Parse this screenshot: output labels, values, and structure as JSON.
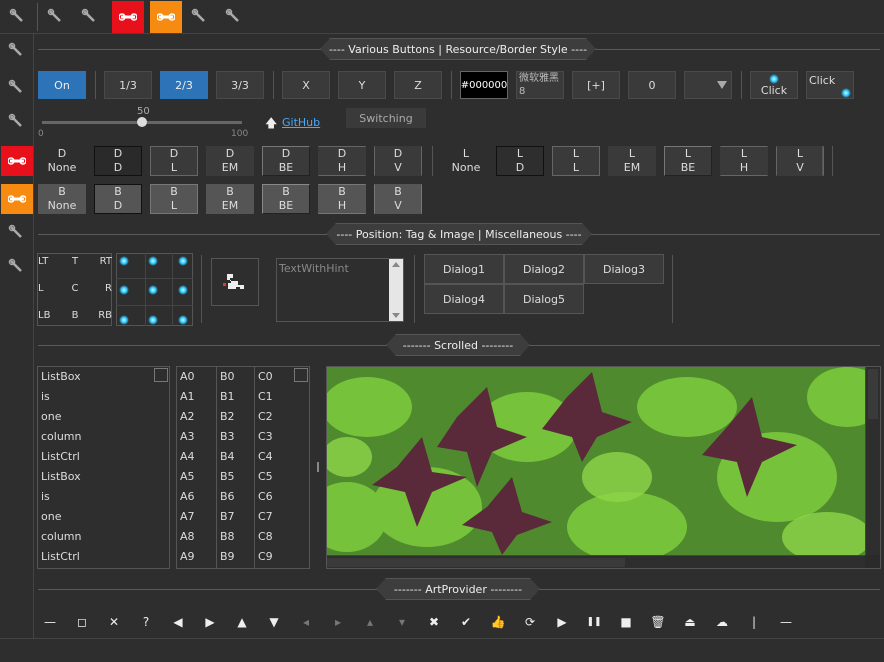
{
  "section_headers": {
    "buttons": "---- Various Buttons | Resource/Border Style ----",
    "position": "---- Position: Tag & Image | Miscellaneous ----",
    "scrolled": "------- Scrolled --------",
    "artprovider": "------- ArtProvider --------"
  },
  "buttons_row": {
    "on": "On",
    "frac1": "1/3",
    "frac2": "2/3",
    "frac3": "3/3",
    "x": "X",
    "y": "Y",
    "z": "Z",
    "color": "#000000",
    "font_line1": "微软雅黑",
    "font_line2": "8",
    "plus": "[+]",
    "zero": "0",
    "click1": "Click",
    "click2": "Click"
  },
  "slider": {
    "max_label": "50",
    "min": "0",
    "max": "100",
    "value": 50
  },
  "github_link": "GitHub",
  "switch_label": "Switching",
  "d_row": [
    {
      "l1": "D",
      "l2": "None"
    },
    {
      "l1": "D",
      "l2": "D"
    },
    {
      "l1": "D",
      "l2": "L"
    },
    {
      "l1": "D",
      "l2": "EM"
    },
    {
      "l1": "D",
      "l2": "BE"
    },
    {
      "l1": "D",
      "l2": "H"
    },
    {
      "l1": "D",
      "l2": "V"
    }
  ],
  "l_row": [
    {
      "l1": "L",
      "l2": "None"
    },
    {
      "l1": "L",
      "l2": "D"
    },
    {
      "l1": "L",
      "l2": "L"
    },
    {
      "l1": "L",
      "l2": "EM"
    },
    {
      "l1": "L",
      "l2": "BE"
    },
    {
      "l1": "L",
      "l2": "H"
    },
    {
      "l1": "L",
      "l2": "V"
    }
  ],
  "b_row": [
    {
      "l1": "B",
      "l2": "None"
    },
    {
      "l1": "B",
      "l2": "D"
    },
    {
      "l1": "B",
      "l2": "L"
    },
    {
      "l1": "B",
      "l2": "EM"
    },
    {
      "l1": "B",
      "l2": "BE"
    },
    {
      "l1": "B",
      "l2": "H"
    },
    {
      "l1": "B",
      "l2": "V"
    }
  ],
  "positions": [
    "LT",
    "T",
    "RT",
    "L",
    "C",
    "R",
    "LB",
    "B",
    "RB"
  ],
  "text_hint": "TextWithHint",
  "dialogs": [
    "Dialog1",
    "Dialog2",
    "Dialog3",
    "Dialog4",
    "Dialog5"
  ],
  "listbox": [
    "ListBox",
    "is",
    "one",
    "column",
    "ListCtrl",
    "ListBox",
    "is",
    "one",
    "column",
    "ListCtrl"
  ],
  "listctrl": {
    "a": [
      "A0",
      "A1",
      "A2",
      "A3",
      "A4",
      "A5",
      "A6",
      "A7",
      "A8",
      "A9"
    ],
    "b": [
      "B0",
      "B1",
      "B2",
      "B3",
      "B4",
      "B5",
      "B6",
      "B7",
      "B8",
      "B9"
    ],
    "c": [
      "C0",
      "C1",
      "C2",
      "C3",
      "C4",
      "C5",
      "C6",
      "C7",
      "C8",
      "C9"
    ]
  },
  "art_icons": [
    "minus-icon",
    "square-icon",
    "close-icon",
    "help-icon",
    "arrow-left-icon",
    "arrow-right-icon",
    "arrow-up-icon",
    "arrow-down-icon",
    "go-back-icon",
    "go-forward-icon",
    "go-up-icon",
    "go-down-icon",
    "cross-icon",
    "check-icon",
    "thumbs-up-icon",
    "repeat-icon",
    "play-icon",
    "pause-icon",
    "stop-icon",
    "trash-icon",
    "upload-icon",
    "cloud-icon",
    "bar-icon",
    "dash-icon"
  ],
  "colors": {
    "accent": "#2d73b8",
    "red": "#e8111b",
    "orange": "#f78a11"
  }
}
